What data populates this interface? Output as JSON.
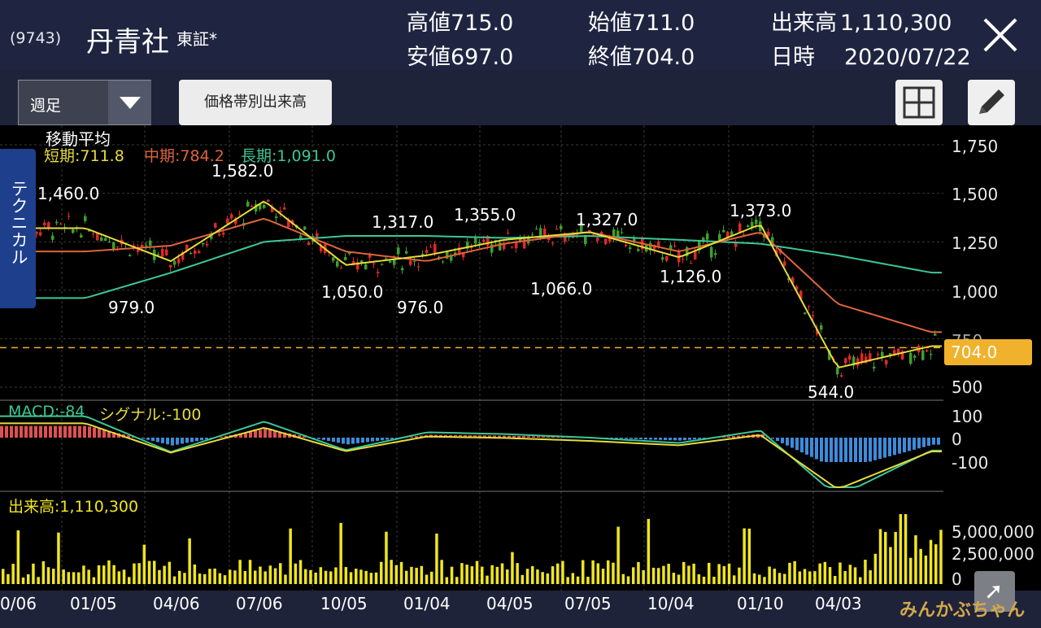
{
  "header": {
    "code": "(9743)",
    "name": "丹青社",
    "market": "東証*",
    "high_label": "高値",
    "high": "715.0",
    "low_label": "安値",
    "low": "697.0",
    "open_label": "始値",
    "open": "711.0",
    "close_label": "終値",
    "close": "704.0",
    "volume_label": "出来高",
    "volume": "1,110,300",
    "date_label": "日時",
    "date": "2020/07/22"
  },
  "toolbar": {
    "period": "週足",
    "volume_by_price": "価格帯別出来高"
  },
  "side_tab": "テクニカル",
  "ma": {
    "title": "移動平均",
    "short": "短期:711.8",
    "mid": "中期:784.2",
    "long": "長期:1,091.0"
  },
  "macd": {
    "label": "MACD:-84",
    "signal": "シグナル:-100"
  },
  "volume_pane": {
    "label": "出来高:1,110,300"
  },
  "current_price": "704.0",
  "price_axis": [
    "1,750",
    "1,500",
    "1,250",
    "1,000",
    "750",
    "500"
  ],
  "macd_axis": [
    "100",
    "0",
    "-100"
  ],
  "volume_axis": [
    "5,000,000",
    "2,500,000",
    "0"
  ],
  "x_axis": [
    "0/06",
    "01/05",
    "04/06",
    "07/06",
    "10/05",
    "01/04",
    "04/05",
    "07/05",
    "10/04",
    "01/10",
    "04/03"
  ],
  "annotations": [
    "1,460.0",
    "979.0",
    "1,582.0",
    "1,050.0",
    "1,317.0",
    "976.0",
    "1,355.0",
    "1,066.0",
    "1,327.0",
    "1,126.0",
    "1,373.0",
    "544.0"
  ],
  "watermark": "みんかぶちゃん",
  "colors": {
    "short_ma": "#e6dc3c",
    "mid_ma": "#e0643c",
    "long_ma": "#3cc896",
    "up": "#3ca02c",
    "down": "#e02828",
    "volume": "#f0e61e",
    "macd_pos": "#e05050",
    "macd_neg": "#3c8cdc",
    "price_tag": "#f0b22c"
  },
  "chart_data": {
    "type": "line",
    "x": [
      "01/05",
      "04/06",
      "07/06",
      "10/05",
      "01/04",
      "04/05",
      "07/05",
      "10/04",
      "01/10",
      "04/03",
      "07/22"
    ],
    "series": [
      {
        "name": "短期",
        "values": [
          1320,
          1150,
          1460,
          1130,
          1180,
          1260,
          1300,
          1170,
          1340,
          600,
          712
        ]
      },
      {
        "name": "中期",
        "values": [
          1200,
          1230,
          1370,
          1200,
          1150,
          1240,
          1300,
          1200,
          1300,
          930,
          784
        ]
      },
      {
        "name": "長期",
        "values": [
          960,
          1090,
          1250,
          1280,
          1280,
          1270,
          1280,
          1260,
          1240,
          1180,
          1091
        ]
      }
    ],
    "ylim": [
      500,
      1750
    ]
  }
}
